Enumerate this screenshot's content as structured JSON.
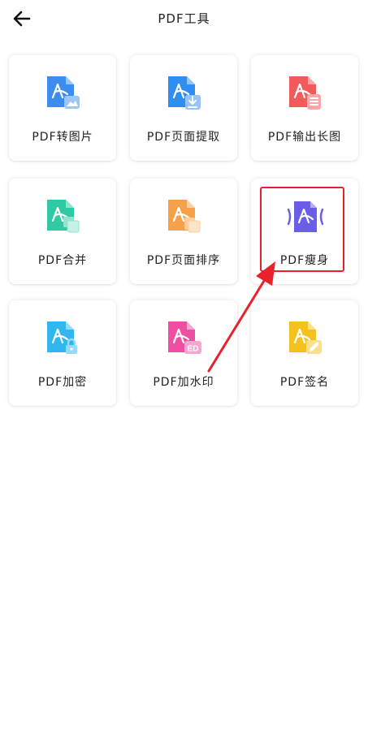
{
  "header": {
    "title": "PDF工具"
  },
  "tools": [
    {
      "label": "PDF转图片",
      "color": "#3d8cf0",
      "badge": "image"
    },
    {
      "label": "PDF页面提取",
      "color": "#2f8ef2",
      "badge": "extract"
    },
    {
      "label": "PDF输出长图",
      "color": "#f05a5a",
      "badge": "doc"
    },
    {
      "label": "PDF合并",
      "color": "#2fc9a4",
      "badge": "merge"
    },
    {
      "label": "PDF页面排序",
      "color": "#f7a04a",
      "badge": "sort"
    },
    {
      "label": "PDF瘦身",
      "color": "#6a5ee8",
      "badge": "slim"
    },
    {
      "label": "PDF加密",
      "color": "#31b7ef",
      "badge": "lock"
    },
    {
      "label": "PDF加水印",
      "color": "#ee4fa2",
      "badge": "watermark",
      "badge_text": "ED"
    },
    {
      "label": "PDF签名",
      "color": "#f4c21e",
      "badge": "sign"
    }
  ],
  "annotation": {
    "highlight_color": "#e8212a",
    "arrow_color": "#e8212a"
  }
}
